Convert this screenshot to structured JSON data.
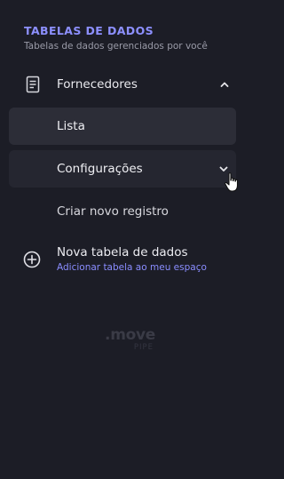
{
  "section": {
    "title": "TABELAS DE DADOS",
    "subtitle": "Tabelas de dados gerenciados por você"
  },
  "group": {
    "label": "Fornecedores",
    "icon": "document-icon",
    "expanded": true
  },
  "sub_items": [
    {
      "label": "Lista",
      "state": "selected"
    },
    {
      "label": "Configurações",
      "state": "hovered"
    },
    {
      "label": "Criar novo registro",
      "state": "default"
    }
  ],
  "new_table": {
    "title": "Nova tabela de dados",
    "subtitle": "Adicionar tabela ao meu espaço",
    "icon": "plus-circle-icon"
  },
  "logo": {
    "main": ".move",
    "sub": "PIPE"
  },
  "colors": {
    "background": "#1c1d26",
    "accent": "#8d90ff",
    "selected_item": "#2c2d37",
    "hover_item": "#252630"
  }
}
